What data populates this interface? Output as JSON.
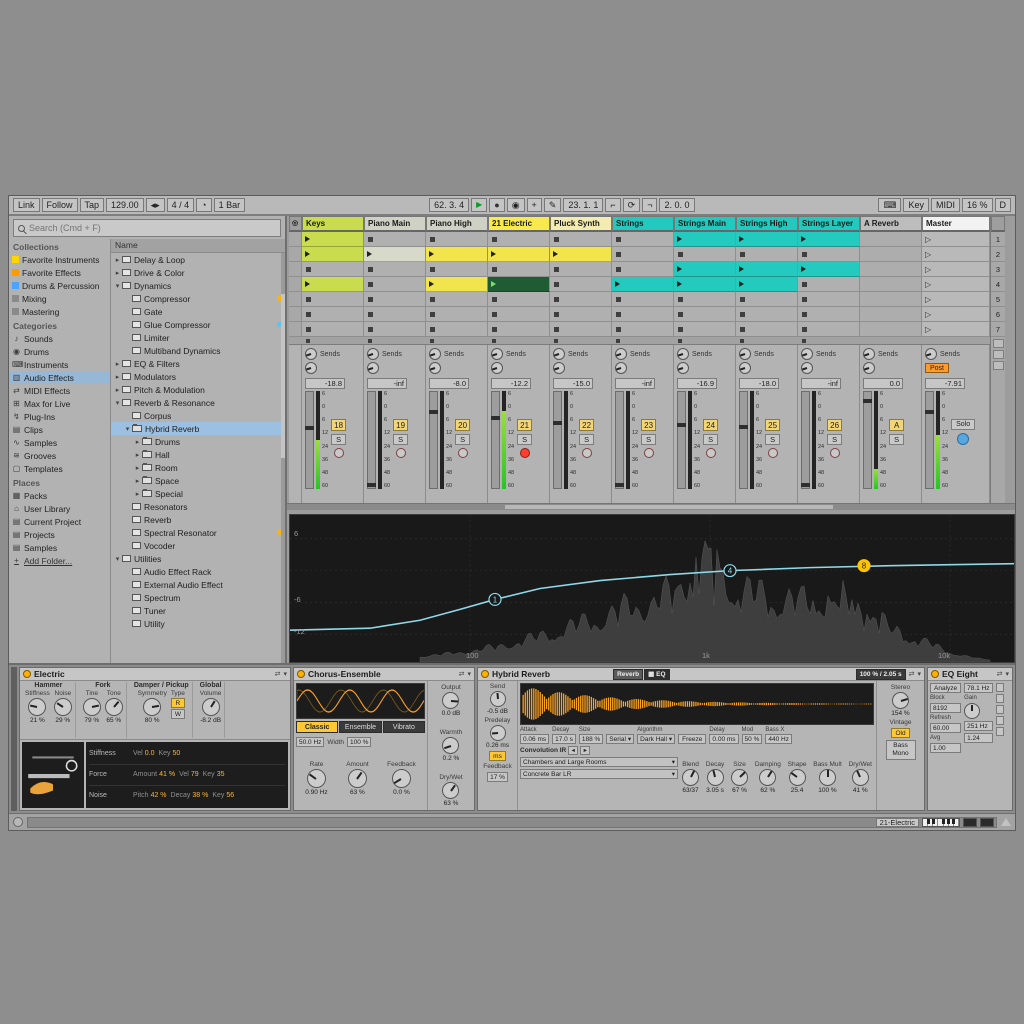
{
  "transport": {
    "link": "Link",
    "follow": "Follow",
    "tap": "Tap",
    "tempo": "129.00",
    "sig": "4 / 4",
    "quantize": "1 Bar",
    "pos": "62. 3. 4",
    "loop_start": "23. 1. 1",
    "loop_len": "2. 0. 0",
    "key": "Key",
    "midi": "MIDI",
    "cpu": "16 %",
    "disk": "D"
  },
  "browser": {
    "search_placeholder": "Search (Cmd + F)",
    "name_header": "Name",
    "sections": [
      {
        "title": "Collections",
        "items": [
          {
            "label": "Favorite Instruments",
            "dot": "#ffd500"
          },
          {
            "label": "Favorite Effects",
            "dot": "#ff9a00"
          },
          {
            "label": "Drums & Percussion",
            "dot": "#4aa3ff"
          },
          {
            "label": "Mixing",
            "dot": "#8a8a8a"
          },
          {
            "label": "Mastering",
            "dot": "#8a8a8a"
          }
        ]
      },
      {
        "title": "Categories",
        "items": [
          {
            "label": "Sounds",
            "icon": "♪"
          },
          {
            "label": "Drums",
            "icon": "◉"
          },
          {
            "label": "Instruments",
            "icon": "⌨"
          },
          {
            "label": "Audio Effects",
            "icon": "▥",
            "selected": true
          },
          {
            "label": "MIDI Effects",
            "icon": "⇄"
          },
          {
            "label": "Max for Live",
            "icon": "⊞"
          },
          {
            "label": "Plug-Ins",
            "icon": "↯"
          },
          {
            "label": "Clips",
            "icon": "▤"
          },
          {
            "label": "Samples",
            "icon": "∿"
          },
          {
            "label": "Grooves",
            "icon": "≋"
          },
          {
            "label": "Templates",
            "icon": "▢"
          }
        ]
      },
      {
        "title": "Places",
        "items": [
          {
            "label": "Packs",
            "icon": "▦"
          },
          {
            "label": "User Library",
            "icon": "⌂"
          },
          {
            "label": "Current Project",
            "icon": "▤"
          },
          {
            "label": "Projects",
            "icon": "▤"
          },
          {
            "label": "Samples",
            "icon": "▤"
          },
          {
            "label": "Add Folder...",
            "icon": "+",
            "add": true
          }
        ]
      }
    ],
    "tree": [
      {
        "label": "Delay & Loop",
        "depth": 0,
        "arrow": "▸",
        "icon": "dev"
      },
      {
        "label": "Drive & Color",
        "depth": 0,
        "arrow": "▸",
        "icon": "dev"
      },
      {
        "label": "Dynamics",
        "depth": 0,
        "arrow": "▾",
        "icon": "dev"
      },
      {
        "label": "Compressor",
        "depth": 1,
        "icon": "dev",
        "dot": "#ffb400"
      },
      {
        "label": "Gate",
        "depth": 1,
        "icon": "dev"
      },
      {
        "label": "Glue Compressor",
        "depth": 1,
        "icon": "dev",
        "dot": "#58c4f0"
      },
      {
        "label": "Limiter",
        "depth": 1,
        "icon": "dev"
      },
      {
        "label": "Multiband Dynamics",
        "depth": 1,
        "icon": "dev"
      },
      {
        "label": "EQ & Filters",
        "depth": 0,
        "arrow": "▸",
        "icon": "dev"
      },
      {
        "label": "Modulators",
        "depth": 0,
        "arrow": "▸",
        "icon": "dev"
      },
      {
        "label": "Pitch & Modulation",
        "depth": 0,
        "arrow": "▸",
        "icon": "dev"
      },
      {
        "label": "Reverb & Resonance",
        "depth": 0,
        "arrow": "▾",
        "icon": "dev"
      },
      {
        "label": "Corpus",
        "depth": 1,
        "icon": "dev"
      },
      {
        "label": "Hybrid Reverb",
        "depth": 1,
        "arrow": "▾",
        "icon": "folder",
        "selected": true
      },
      {
        "label": "Drums",
        "depth": 2,
        "arrow": "▸",
        "icon": "folder"
      },
      {
        "label": "Hall",
        "depth": 2,
        "arrow": "▸",
        "icon": "folder"
      },
      {
        "label": "Room",
        "depth": 2,
        "arrow": "▸",
        "icon": "folder"
      },
      {
        "label": "Space",
        "depth": 2,
        "arrow": "▸",
        "icon": "folder"
      },
      {
        "label": "Special",
        "depth": 2,
        "arrow": "▸",
        "icon": "folder"
      },
      {
        "label": "Resonators",
        "depth": 1,
        "icon": "dev"
      },
      {
        "label": "Reverb",
        "depth": 1,
        "icon": "dev"
      },
      {
        "label": "Spectral Resonator",
        "depth": 1,
        "icon": "dev",
        "dot": "#ffb400"
      },
      {
        "label": "Vocoder",
        "depth": 1,
        "icon": "dev"
      },
      {
        "label": "Utilities",
        "depth": 0,
        "arrow": "▾",
        "icon": "dev"
      },
      {
        "label": "Audio Effect Rack",
        "depth": 1,
        "icon": "dev"
      },
      {
        "label": "External Audio Effect",
        "depth": 1,
        "icon": "dev"
      },
      {
        "label": "Spectrum",
        "depth": 1,
        "icon": "dev"
      },
      {
        "label": "Tuner",
        "depth": 1,
        "icon": "dev"
      },
      {
        "label": "Utility",
        "depth": 1,
        "icon": "dev"
      }
    ]
  },
  "session": {
    "sends_label": "Sends",
    "scene_numbers": [
      "1",
      "2",
      "3",
      "4",
      "5",
      "6",
      "7"
    ],
    "fader_scale": [
      "6",
      "0",
      "6",
      "12",
      "24",
      "36",
      "48",
      "60"
    ],
    "clip_colors": {
      "lime": {
        "c": "#c9dc4e"
      },
      "yellow": {
        "c": "#f2e44c"
      },
      "teal": {
        "c": "#25cabe"
      },
      "hatch": {
        "c": "#d8dac9",
        "hatch": true
      },
      "hatch-yellow": {
        "c": "#f2e44c",
        "hatch": true
      },
      "rec": {
        "c": "#1f5c33",
        "t": "#7be06a"
      }
    },
    "tracks": [
      {
        "name": "Keys",
        "color": "#c9dc4e",
        "num": "18",
        "db": "-18.8",
        "meter": 0.5,
        "slots": [
          "lime",
          "lime",
          "stop",
          "lime",
          "stop",
          "stop",
          "stop"
        ]
      },
      {
        "name": "Piano Main",
        "color": "#ced1c3",
        "num": "19",
        "db": "-inf",
        "meter": 0,
        "slots": [
          "stop",
          "hatch",
          "stop",
          "stop",
          "stop",
          "stop",
          "stop"
        ]
      },
      {
        "name": "Piano High",
        "color": "#ced1c3",
        "num": "20",
        "db": "-8.0",
        "meter": 0,
        "slots": [
          "stop",
          "yellow",
          "stop",
          "yellow",
          "stop",
          "stop",
          "stop"
        ]
      },
      {
        "name": "21 Electric",
        "color": "#f7e94e",
        "num": "21",
        "db": "-12.2",
        "meter": 0.8,
        "armed": true,
        "slots": [
          "stop",
          "yellow",
          "stop",
          "rec",
          "stop",
          "stop",
          "stop"
        ]
      },
      {
        "name": "Pluck Synth",
        "color": "#f3ecb0",
        "num": "22",
        "db": "-15.0",
        "meter": 0,
        "slots": [
          "stop",
          "hatch-yellow",
          "stop",
          "stop",
          "stop",
          "stop",
          "stop"
        ]
      },
      {
        "name": "Strings",
        "color": "#23c9be",
        "num": "23",
        "db": "-inf",
        "meter": 0,
        "slots": [
          "stop",
          "stop",
          "stop",
          "teal",
          "stop",
          "stop",
          "stop"
        ]
      },
      {
        "name": "Strings Main",
        "color": "#23c9be",
        "num": "24",
        "db": "-16.9",
        "meter": 0,
        "slots": [
          "teal",
          "stop",
          "teal",
          "teal",
          "stop",
          "stop",
          "stop"
        ]
      },
      {
        "name": "Strings High",
        "color": "#23c9be",
        "num": "25",
        "db": "-18.0",
        "meter": 0,
        "slots": [
          "teal",
          "stop",
          "teal",
          "teal",
          "stop",
          "stop",
          "stop"
        ]
      },
      {
        "name": "Strings Layer",
        "color": "#23c9be",
        "num": "26",
        "db": "-inf",
        "meter": 0,
        "slots": [
          "teal",
          "stop",
          "teal",
          "stop",
          "stop",
          "stop",
          "stop"
        ]
      }
    ],
    "return_track": {
      "name": "A Reverb",
      "num": "A",
      "db": "0.0",
      "meter": 0.2
    },
    "master": {
      "name": "Master",
      "db": "-7.91",
      "post": "Post",
      "solo": "Solo",
      "meter": 0.55
    }
  },
  "eq_display": {
    "db_labels": [
      "6",
      "-6",
      "-12"
    ],
    "freq_labels": [
      "100",
      "1k",
      "10k"
    ],
    "markers": [
      "1",
      "4",
      "8"
    ]
  },
  "devices": {
    "electric": {
      "title": "Electric",
      "sections": [
        {
          "title": "Hammer",
          "knobs": [
            {
              "label": "Stiffness",
              "value": "21 %",
              "frac": 0.21
            },
            {
              "label": "Noise",
              "value": "29 %",
              "frac": 0.29
            }
          ]
        },
        {
          "title": "Fork",
          "knobs": [
            {
              "label": "Tine",
              "value": "79 %",
              "frac": 0.79
            },
            {
              "label": "Tone",
              "value": "65 %",
              "frac": 0.65
            }
          ]
        },
        {
          "title": "Damper / Pickup",
          "knobs": [
            {
              "label": "Symmetry",
              "value": "80 %",
              "frac": 0.8
            }
          ],
          "type_label": "Type",
          "type_options": [
            "R",
            "W"
          ],
          "type_active": 0
        },
        {
          "title": "Global",
          "knobs": [
            {
              "label": "Volume",
              "value": "-8.2 dB",
              "frac": 0.62
            }
          ]
        }
      ],
      "table": [
        {
          "name": "Stiffness",
          "cells": [
            {
              "label": "Vel",
              "value": "0.0"
            },
            {
              "label": "Key",
              "value": "50"
            }
          ]
        },
        {
          "name": "Force",
          "cells": [
            {
              "label": "Amount",
              "value": "41 %"
            },
            {
              "label": "Vel",
              "value": "79"
            },
            {
              "label": "Key",
              "value": "35"
            }
          ]
        },
        {
          "name": "Noise",
          "cells": [
            {
              "label": "Pitch",
              "value": "42 %"
            },
            {
              "label": "Decay",
              "value": "38 %"
            },
            {
              "label": "Key",
              "value": "56"
            }
          ]
        }
      ]
    },
    "chorus": {
      "title": "Chorus-Ensemble",
      "tabs": [
        "Classic",
        "Ensemble",
        "Vibrato"
      ],
      "active_tab": 0,
      "hz_box": "50.0 Hz",
      "width_label": "Width",
      "width_value": "100 %",
      "knobs": [
        {
          "label": "Rate",
          "value": "0.90 Hz",
          "frac": 0.3
        },
        {
          "label": "Amount",
          "value": "63 %",
          "frac": 0.63
        },
        {
          "label": "Feedback",
          "value": "0.0 %",
          "frac": 0.05
        }
      ],
      "side_knobs": [
        {
          "label": "Output",
          "value": "0.0 dB",
          "frac": 0.85
        },
        {
          "label": "Warmth",
          "value": "0.2 %",
          "frac": 0.1
        },
        {
          "label": "Dry/Wet",
          "value": "63 %",
          "frac": 0.63
        }
      ]
    },
    "hybrid": {
      "title": "Hybrid Reverb",
      "tab_reverb": "Reverb",
      "tab_eq": "EQ",
      "time_display": "100 % / 2.05 s",
      "left_knobs": [
        {
          "label": "Send",
          "value": "-0.5 dB",
          "frac": 0.48
        },
        {
          "label": "Predelay",
          "value": "0.26 ms",
          "frac": 0.15
        }
      ],
      "ms_button": "ms",
      "feedback_label": "Feedback",
      "feedback_value": "17 %",
      "params": [
        {
          "label": "Attack",
          "value": "0.06 ms"
        },
        {
          "label": "Decay",
          "value": "17.0 s"
        },
        {
          "label": "Size",
          "value": "188 %"
        },
        {
          "label": "",
          "value": "Serial",
          "dd": true
        },
        {
          "label": "Algorithm",
          "value": "Dark Hall",
          "dd": true
        },
        {
          "label": "",
          "value": "Freeze",
          "btn": true
        },
        {
          "label": "Delay",
          "value": "0.00 ms"
        },
        {
          "label": "Mod",
          "value": "50 %"
        },
        {
          "label": "Bass X",
          "value": "440 Hz"
        }
      ],
      "conv_title": "Convolution IR",
      "ir_category": "Chambers and Large Rooms",
      "ir_file": "Concrete Bar LR",
      "knobs": [
        {
          "label": "Blend",
          "value": "63/37",
          "frac": 0.6
        },
        {
          "label": "Decay",
          "value": "3.05 s",
          "frac": 0.45
        },
        {
          "label": "Size",
          "value": "67 %",
          "frac": 0.67
        },
        {
          "label": "Damping",
          "value": "62 %",
          "frac": 0.62
        },
        {
          "label": "Shape",
          "value": "25.4",
          "frac": 0.3
        },
        {
          "label": "Bass Mult",
          "value": "100 %",
          "frac": 0.5
        },
        {
          "label": "Dry/Wet",
          "value": "41 %",
          "frac": 0.41
        }
      ],
      "stereo_label": "Stereo",
      "stereo_value": "154 %",
      "stereo_frac": 0.77,
      "vintage_label": "Vintage",
      "vintage_value": "Old",
      "bass_mono": "Bass Mono"
    },
    "eq_eight": {
      "title": "EQ Eight",
      "analyze": "Analyze",
      "fields": [
        {
          "label": "Block",
          "value": "8192"
        },
        {
          "label": "Refresh",
          "value": "60.00"
        },
        {
          "label": "Avg",
          "value": "1.00"
        }
      ],
      "freq_value": "78.1 Hz",
      "gain_label": "Gain",
      "freq2_value": "251 Hz",
      "q_value": "1.24"
    }
  },
  "status": {
    "clip_name": "21-Electric"
  }
}
